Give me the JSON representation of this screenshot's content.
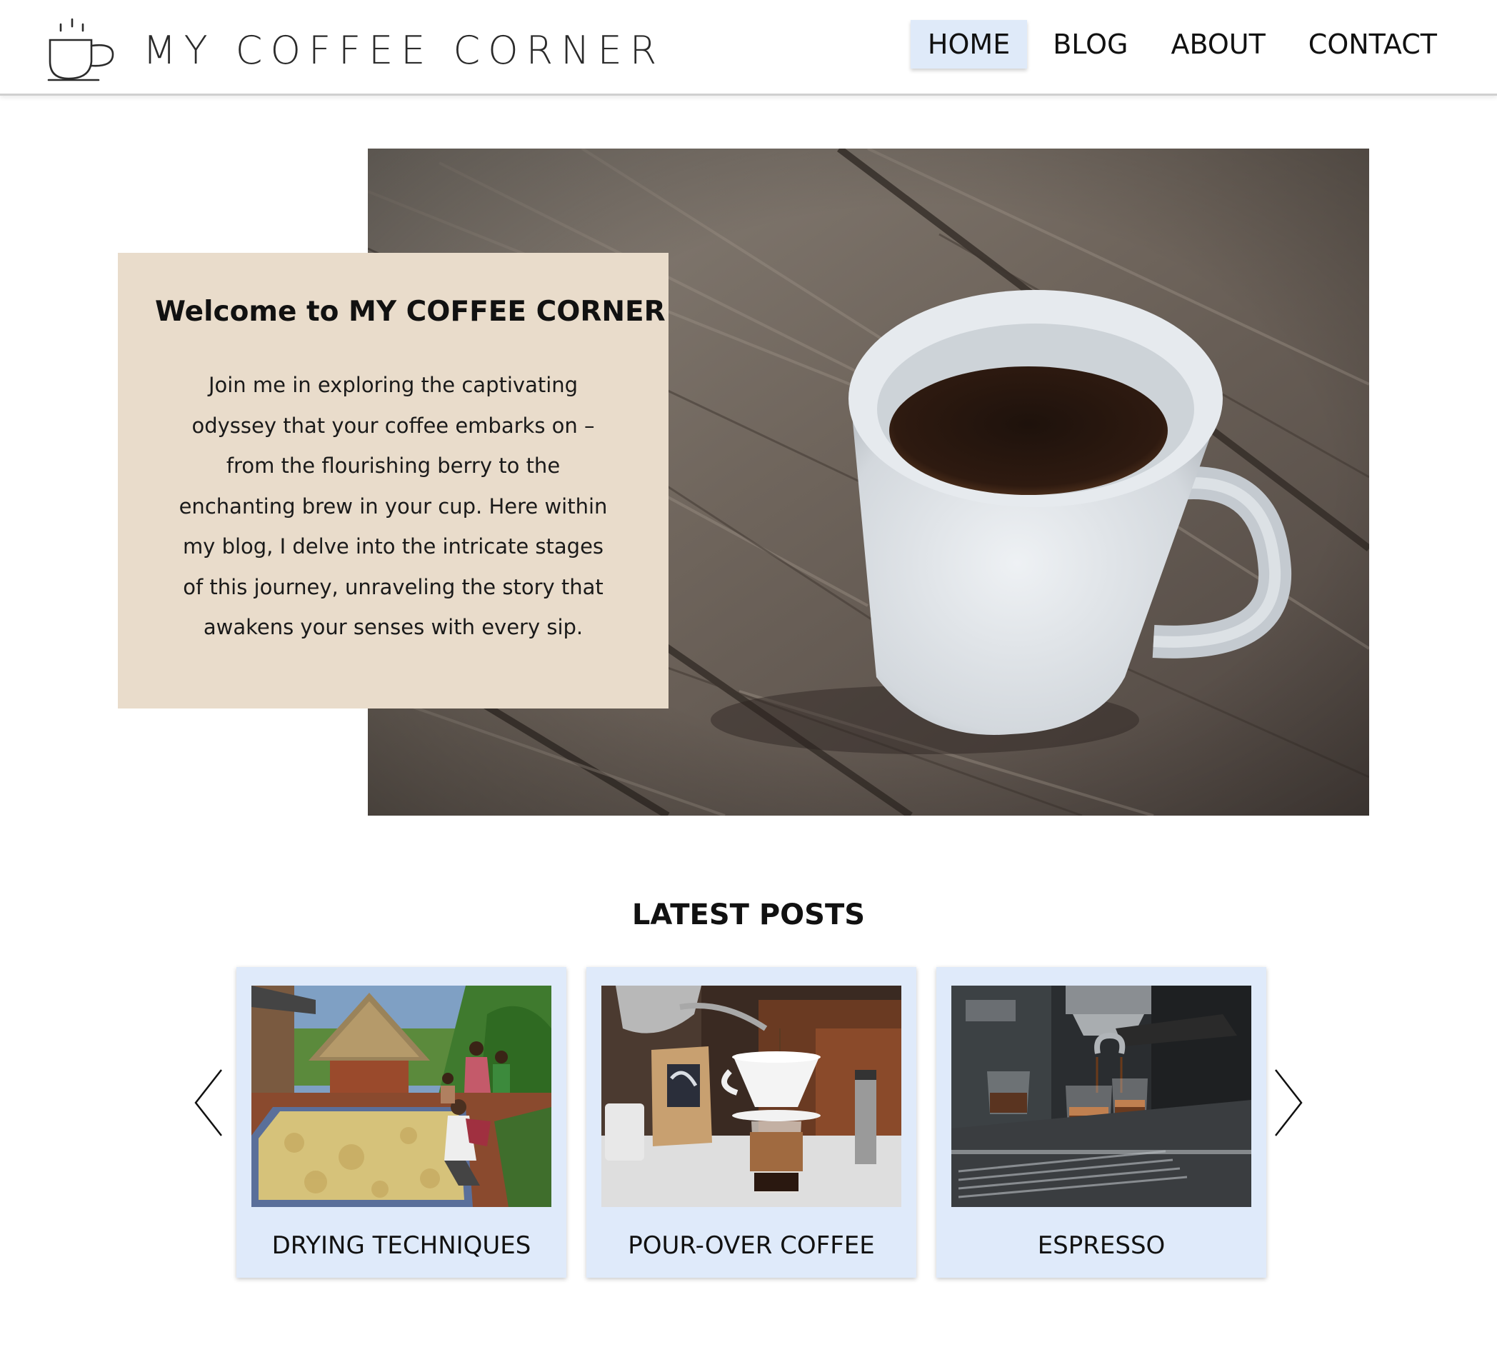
{
  "header": {
    "logo_text": "MY COFFEE CORNER",
    "logo_icon": "coffee-cup-icon",
    "nav": [
      {
        "label": "HOME",
        "active": true
      },
      {
        "label": "BLOG",
        "active": false
      },
      {
        "label": "ABOUT",
        "active": false
      },
      {
        "label": "CONTACT",
        "active": false
      }
    ]
  },
  "hero": {
    "image": "coffee-mug-on-wooden-table",
    "title": "Welcome to MY COFFEE CORNER",
    "body": "Join me in exploring the captivating odyssey that your coffee embarks on – from the flourishing berry to the enchanting brew in your cup. Here within my blog, I delve into the intricate stages of this journey, unraveling the story that awakens your senses with every sip."
  },
  "latest_posts": {
    "heading": "LATEST POSTS",
    "prev_icon": "chevron-left-icon",
    "next_icon": "chevron-right-icon",
    "posts": [
      {
        "title": "DRYING TECHNIQUES",
        "image": "coffee-beans-drying-photo"
      },
      {
        "title": "POUR-OVER COFFEE",
        "image": "pour-over-brewing-photo"
      },
      {
        "title": "ESPRESSO",
        "image": "espresso-machine-photo"
      }
    ]
  },
  "colors": {
    "nav_active_bg": "#dfeaf9",
    "welcome_card_bg": "#e9dccb",
    "post_card_bg": "#dfeafa",
    "header_border": "#d0d0d0"
  }
}
